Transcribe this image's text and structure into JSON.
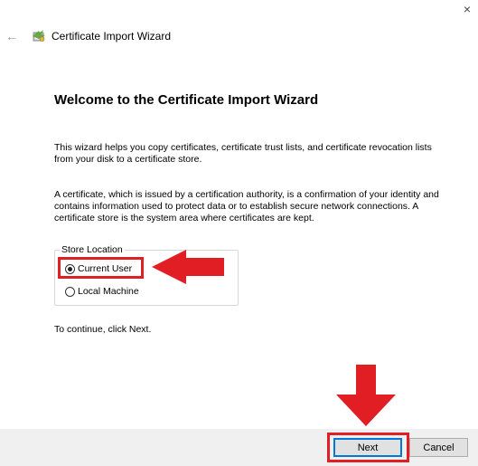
{
  "window": {
    "title": "Certificate Import Wizard",
    "close_glyph": "×",
    "back_glyph": "←"
  },
  "page": {
    "heading": "Welcome to the Certificate Import Wizard",
    "paragraph1": "This wizard helps you copy certificates, certificate trust lists, and certificate revocation lists from your disk to a certificate store.",
    "paragraph2": "A certificate, which is issued by a certification authority, is a confirmation of your identity and contains information used to protect data or to establish secure network connections. A certificate store is the system area where certificates are kept.",
    "store_location": {
      "legend": "Store Location",
      "options": [
        {
          "label": "Current User",
          "selected": true
        },
        {
          "label": "Local Machine",
          "selected": false
        }
      ]
    },
    "continue_text": "To continue, click Next."
  },
  "buttons": {
    "next": "Next",
    "cancel": "Cancel"
  },
  "icons": {
    "back": "back-arrow-icon",
    "wizard": "certificate-wizard-icon",
    "annotation_arrows": "red-arrow-icon"
  },
  "colors": {
    "annotation_red": "#e01e24",
    "default_button_border": "#0078d7",
    "footer_bg": "#f0f0f0"
  }
}
